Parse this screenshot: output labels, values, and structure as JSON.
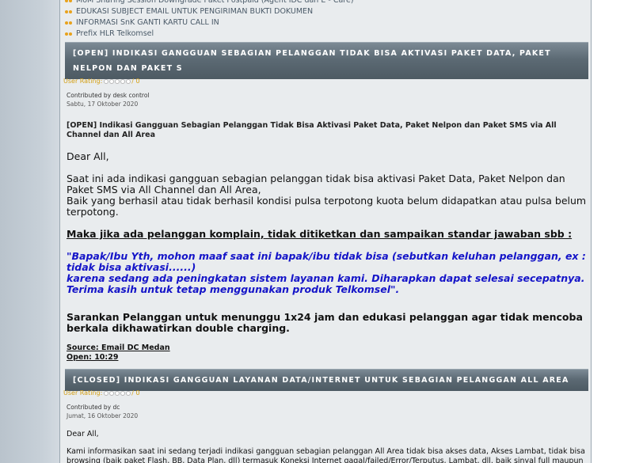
{
  "related": [
    "MoM Sharing Session Downgrade Paket Postpaid (Agent IDC dan E - Care)",
    "EDUKASI SUBJECT EMAIL UNTUK PENGIRIMAN BUKTI DOKUMEN",
    "INFORMASI SnK GANTI KARTU CALL IN",
    "Prefix HLR Telkomsel"
  ],
  "articles": [
    {
      "header": "[OPEN] INDIKASI GANGGUAN SEBAGIAN PELANGGAN TIDAK BISA AKTIVASI PAKET DATA, PAKET NELPON DAN PAKET S",
      "rating_label": "User Rating:",
      "rating_count": "/ 0",
      "contributed": "Contributed by desk control",
      "date": "Sabtu, 17 Oktober 2020",
      "title": "[OPEN] Indikasi Gangguan Sebagian Pelanggan Tidak Bisa Aktivasi Paket Data, Paket Nelpon dan Paket SMS via All Channel dan All Area",
      "greeting": "Dear All,",
      "para1": "Saat ini ada indikasi gangguan sebagian pelanggan tidak bisa aktivasi Paket Data, Paket Nelpon dan Paket SMS via All Channel dan All Area,",
      "para2": "Baik yang berhasil atau tidak berhasil kondisi pulsa terpotong kuota belum didapatkan atau pulsa belum terpotong.",
      "instruction": "Maka jika ada pelanggan komplain, tidak ditiketkan dan sampaikan standar jawaban sbb :",
      "quote1": "\"Bapak/Ibu Yth, mohon maaf saat ini bapak/ibu tidak bisa (sebutkan keluhan pelanggan, ex : tidak bisa aktivasi......)",
      "quote2": "karena sedang ada peningkatan sistem layanan kami. Diharapkan dapat selesai secepatnya.",
      "quote3": "Terima kasih untuk tetap menggunakan produk Telkomsel\".",
      "advice": "Sarankan Pelanggan untuk menunggu 1x24 jam dan edukasi pelanggan agar tidak mencoba berkala dikhawatirkan double charging.",
      "source": "Source: Email DC Medan",
      "open_time": "Open: 10:29"
    },
    {
      "header": "[CLOSED] INDIKASI GANGGUAN LAYANAN DATA/INTERNET UNTUK SEBAGIAN PELANGGAN ALL AREA",
      "rating_label": "User Rating:",
      "rating_count": "/ 0",
      "contributed": "Contributed by dc",
      "date": "Jumat, 16 Oktober 2020",
      "greeting": "Dear All,",
      "para1": "Kami informasikan saat ini sedang terjadi indikasi gangguan sebagian pelanggan All Area tidak bisa akses data, Akses Lambat, tidak bisa browsing (baik paket Flash, BB, Data Plan, dll) termasuk Koneksi Internet gagal/failed/Error/Terputus, Lambat, dll. baik sinyal full maupun"
    }
  ]
}
